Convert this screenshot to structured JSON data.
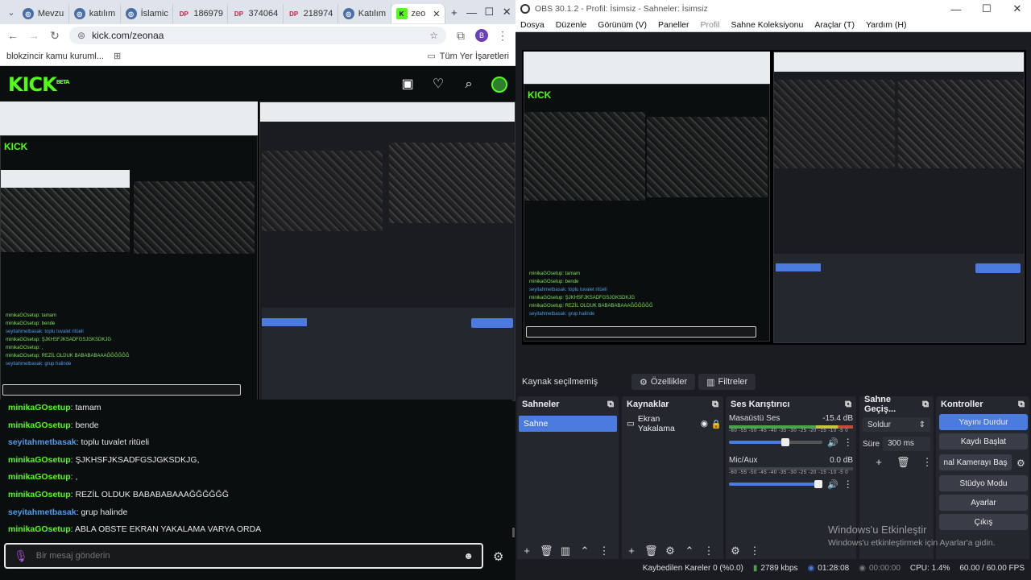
{
  "browser": {
    "tabs": [
      {
        "label": "Mevzu",
        "icon": "globe-icon"
      },
      {
        "label": "katılım",
        "icon": "globe-icon"
      },
      {
        "label": "İslamic",
        "icon": "globe-icon"
      },
      {
        "label": "186979",
        "icon": "dp-icon"
      },
      {
        "label": "374064",
        "icon": "dp-icon"
      },
      {
        "label": "218974",
        "icon": "dp-icon"
      },
      {
        "label": "Katılım",
        "icon": "globe-icon"
      },
      {
        "label": "zeo",
        "icon": "kick-icon"
      }
    ],
    "url": "kick.com/zeonaa",
    "bookmark_left": "blokzincir kamu kuruml...",
    "bookmark_right": "Tüm Yer İşaretleri",
    "profile_initial": "B"
  },
  "kick": {
    "logo": "KICK",
    "logo_sup": "BETA",
    "chat": [
      {
        "user": "minikaGOsetup",
        "text": "tamam",
        "color": "#53fc18"
      },
      {
        "user": "minikaGOsetup",
        "text": "bende",
        "color": "#53fc18"
      },
      {
        "user": "seyitahmetbasak",
        "text": "toplu tuvalet ritüeli",
        "color": "#4f9be8"
      },
      {
        "user": "minikaGOsetup",
        "text": "ŞJKHSFJKSADFGSJGKSDKJG,",
        "color": "#53fc18"
      },
      {
        "user": "minikaGOsetup",
        "text": ",",
        "color": "#53fc18"
      },
      {
        "user": "minikaGOsetup",
        "text": "REZİL OLDUK BABABABAAAĞĞĞĞĞĞ",
        "color": "#53fc18"
      },
      {
        "user": "seyitahmetbasak",
        "text": "grup halinde",
        "color": "#4f9be8"
      },
      {
        "user": "minikaGOsetup",
        "text": "ABLA OBSTE EKRAN YAKALAMA VARYA ORDA",
        "color": "#53fc18"
      }
    ],
    "chat_placeholder": "Bir mesaj gönderin"
  },
  "obs": {
    "title": "OBS 30.1.2 - Profil: İsimsiz - Sahneler: İsimsiz",
    "menu": [
      "Dosya",
      "Düzenle",
      "Görünüm (V)",
      "Paneller",
      "Profil",
      "Sahne Koleksiyonu",
      "Araçlar (T)",
      "Yardım (H)"
    ],
    "source_status": "Kaynak seçilmemiş",
    "properties_btn": "Özellikler",
    "filters_btn": "Filtreler",
    "docks": {
      "scenes": {
        "title": "Sahneler",
        "items": [
          "Sahne"
        ]
      },
      "sources": {
        "title": "Kaynaklar",
        "items": [
          "Ekran Yakalama"
        ]
      },
      "mixer": {
        "title": "Ses Karıştırıcı",
        "tracks": [
          {
            "name": "Masaüstü Ses",
            "db": "-15.4 dB",
            "level": 0.6
          },
          {
            "name": "Mic/Aux",
            "db": "0.0 dB",
            "level": 0.98
          }
        ],
        "ticks": "-60 -55 -50 -45 -40 -35 -30 -25 -20 -15 -10 -5 0"
      },
      "transitions": {
        "title": "Sahne Geçiş...",
        "type": "Soldur",
        "duration_label": "Süre",
        "duration": "300 ms"
      },
      "controls": {
        "title": "Kontroller",
        "buttons": [
          "Yayını Durdur",
          "Kaydı Başlat",
          "nal Kamerayı Baş",
          "Stüdyo Modu",
          "Ayarlar",
          "Çıkış"
        ]
      }
    },
    "status": {
      "dropped": "Kaybedilen Kareler 0 (%0.0)",
      "bitrate": "2789 kbps",
      "stream_time": "01:28:08",
      "rec_time": "00:00:00",
      "cpu": "CPU: 1.4%",
      "fps": "60.00 / 60.00 FPS"
    },
    "watermark": {
      "title": "Windows'u Etkinleştir",
      "sub": "Windows'u etkinleştirmek için Ayarlar'a gidin."
    }
  },
  "colors": {
    "kick_green": "#53fc18",
    "obs_blue": "#4b7bdf",
    "obs_bg": "#1b1c21"
  }
}
